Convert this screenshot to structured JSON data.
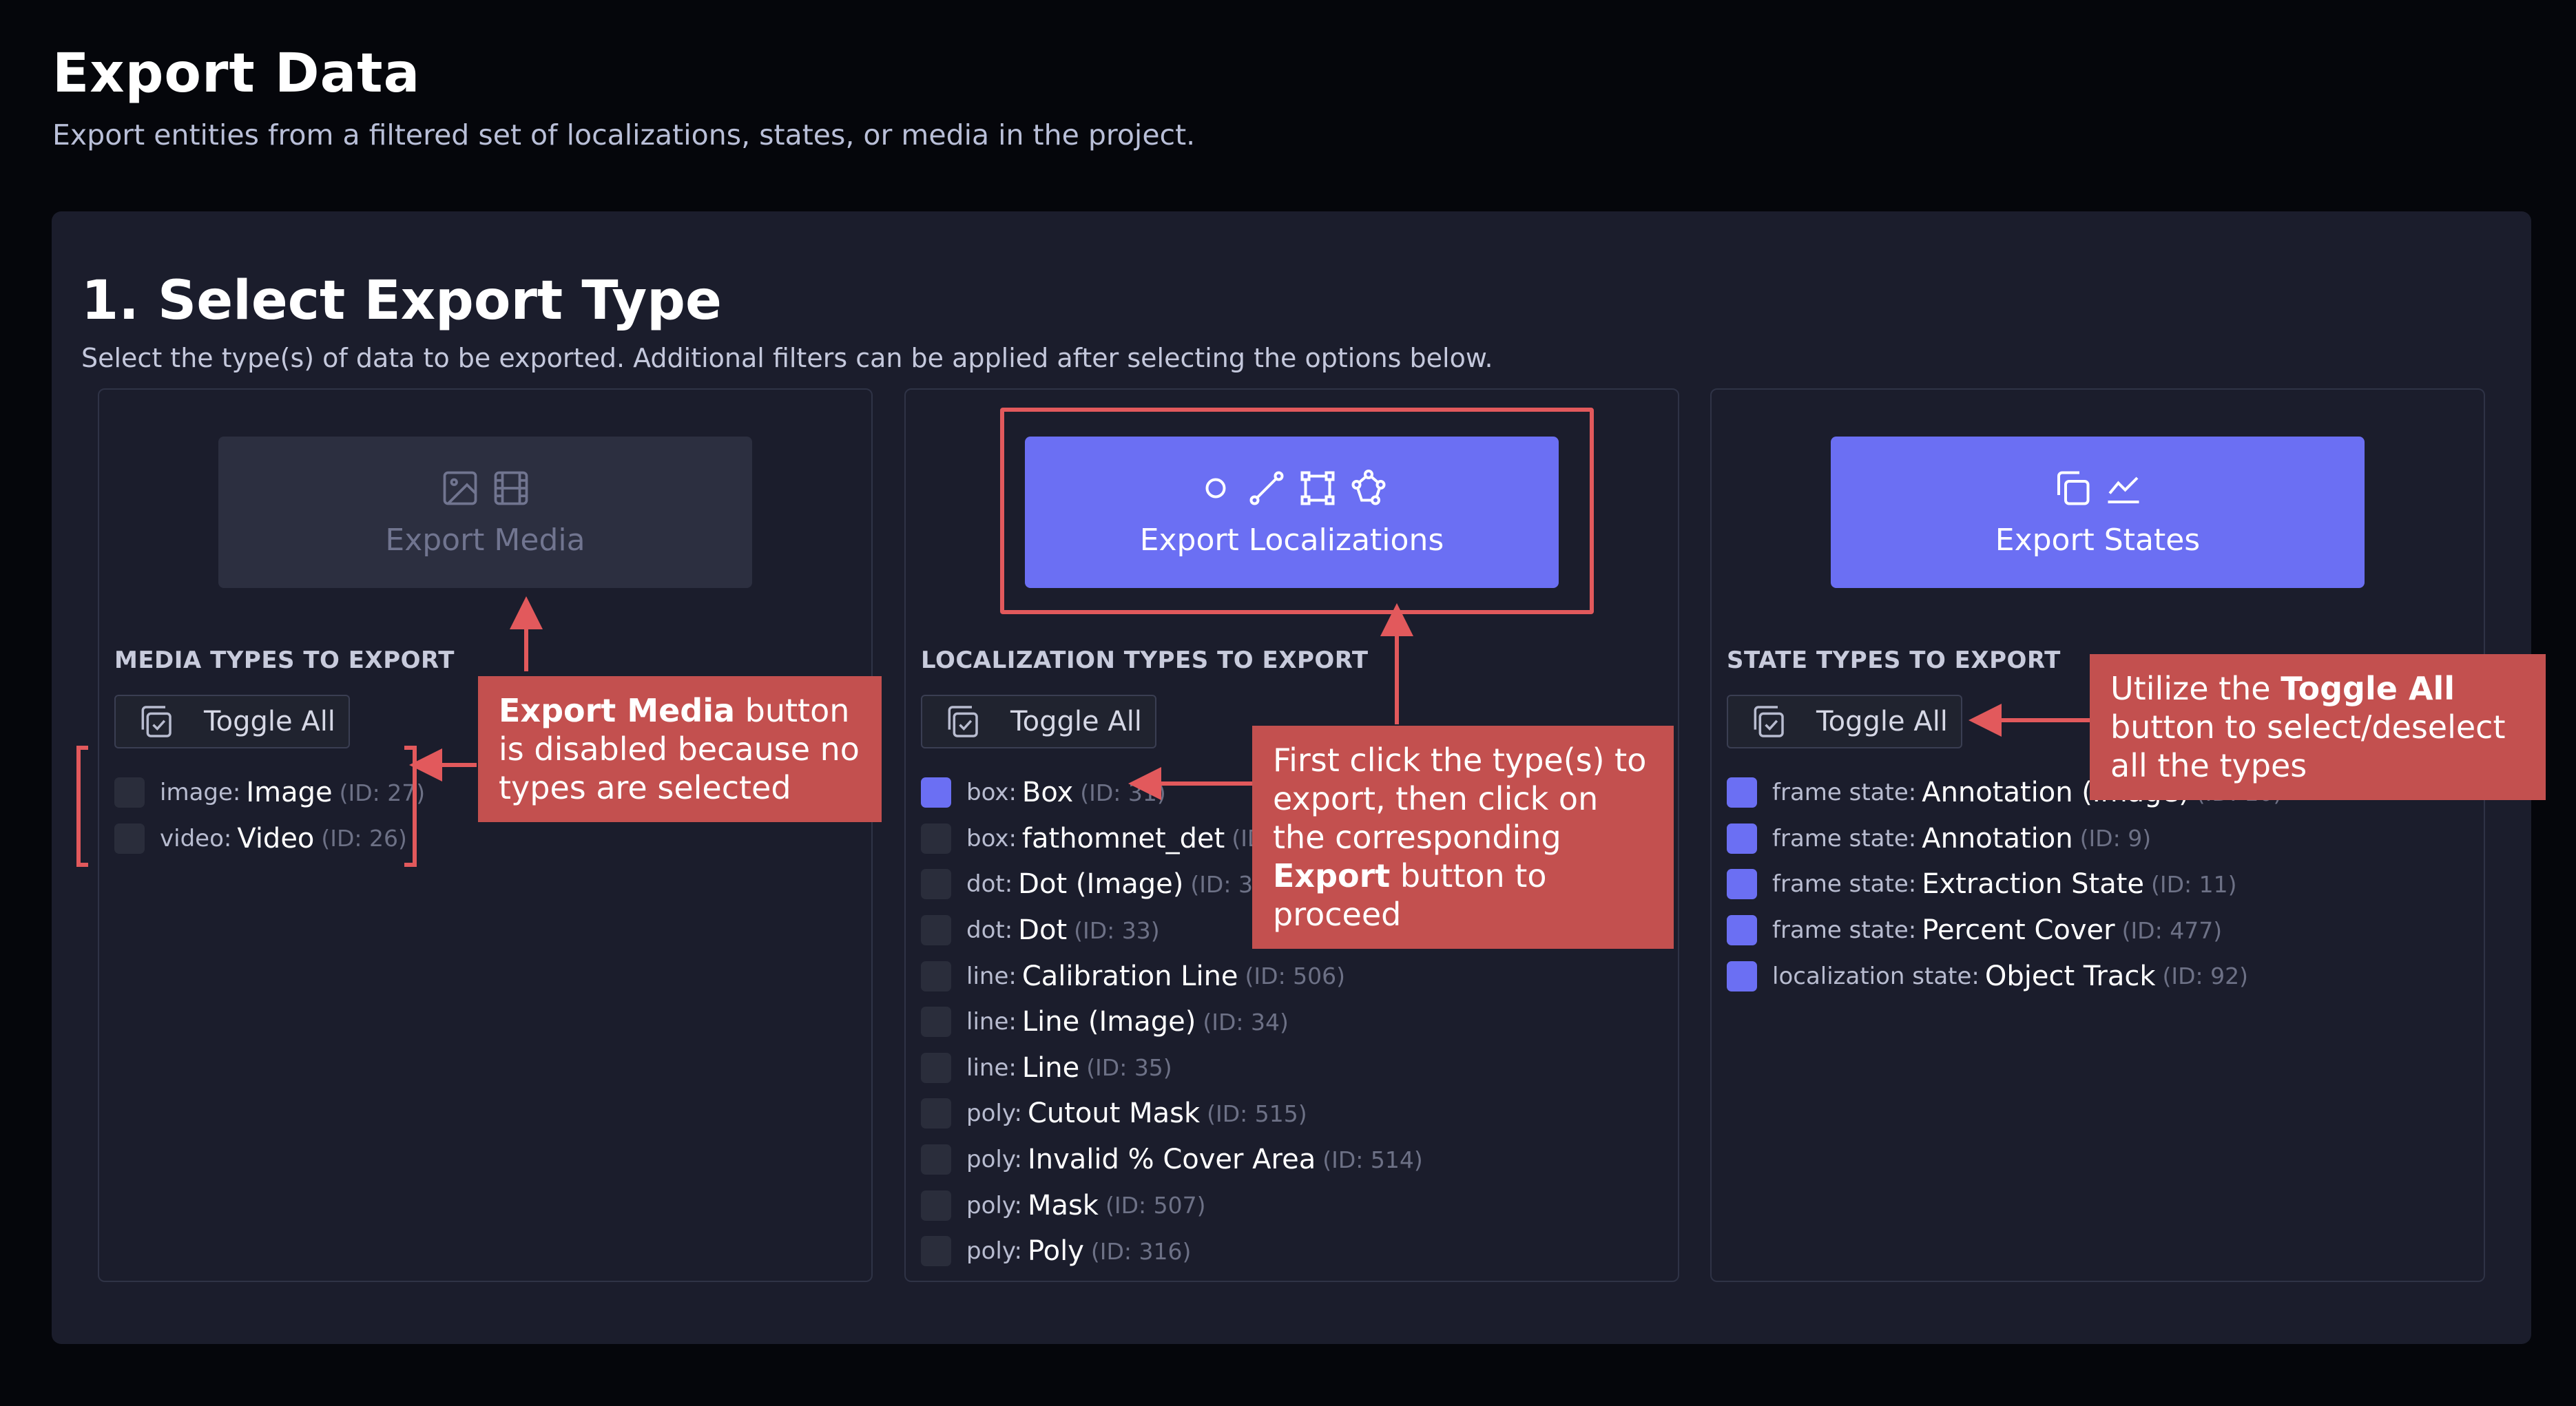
{
  "page": {
    "title": "Export Data",
    "subtitle": "Export entities from a filtered set of localizations, states, or media in the project."
  },
  "section": {
    "title": "1. Select Export Type",
    "subtitle": "Select the type(s) of data to be exported. Additional filters can be applied after selecting the options below."
  },
  "media": {
    "button_label": "Export Media",
    "button_icons": [
      "image-icon",
      "film-icon"
    ],
    "heading": "MEDIA TYPES TO EXPORT",
    "toggle_label": "Toggle All",
    "items": [
      {
        "prefix": "image:",
        "name": "Image",
        "id": "(ID: 27)",
        "checked": false
      },
      {
        "prefix": "video:",
        "name": "Video",
        "id": "(ID: 26)",
        "checked": false
      }
    ]
  },
  "localizations": {
    "button_label": "Export Localizations",
    "button_icons": [
      "dot-icon",
      "line-icon",
      "box-icon",
      "poly-icon"
    ],
    "heading": "LOCALIZATION TYPES TO EXPORT",
    "toggle_label": "Toggle All",
    "items": [
      {
        "prefix": "box:",
        "name": "Box",
        "id": "(ID: 31)",
        "checked": true
      },
      {
        "prefix": "box:",
        "name": "fathomnet_det",
        "id": "(ID: 5",
        "checked": false
      },
      {
        "prefix": "dot:",
        "name": "Dot (Image)",
        "id": "(ID: 32)",
        "checked": false
      },
      {
        "prefix": "dot:",
        "name": "Dot",
        "id": "(ID: 33)",
        "checked": false
      },
      {
        "prefix": "line:",
        "name": "Calibration Line",
        "id": "(ID: 506)",
        "checked": false
      },
      {
        "prefix": "line:",
        "name": "Line (Image)",
        "id": "(ID: 34)",
        "checked": false
      },
      {
        "prefix": "line:",
        "name": "Line",
        "id": "(ID: 35)",
        "checked": false
      },
      {
        "prefix": "poly:",
        "name": "Cutout Mask",
        "id": "(ID: 515)",
        "checked": false
      },
      {
        "prefix": "poly:",
        "name": "Invalid % Cover Area",
        "id": "(ID: 514)",
        "checked": false
      },
      {
        "prefix": "poly:",
        "name": "Mask",
        "id": "(ID: 507)",
        "checked": false
      },
      {
        "prefix": "poly:",
        "name": "Poly",
        "id": "(ID: 316)",
        "checked": false
      }
    ]
  },
  "states": {
    "button_label": "Export States",
    "button_icons": [
      "copy-icon",
      "chart-line-icon"
    ],
    "heading": "STATE TYPES TO EXPORT",
    "toggle_label": "Toggle All",
    "items": [
      {
        "prefix": "frame state:",
        "name": "Annotation (Image)",
        "id": "(ID: 10)",
        "checked": true
      },
      {
        "prefix": "frame state:",
        "name": "Annotation",
        "id": "(ID: 9)",
        "checked": true
      },
      {
        "prefix": "frame state:",
        "name": "Extraction State",
        "id": "(ID: 11)",
        "checked": true
      },
      {
        "prefix": "frame state:",
        "name": "Percent Cover",
        "id": "(ID: 477)",
        "checked": true
      },
      {
        "prefix": "localization state:",
        "name": "Object Track",
        "id": "(ID: 92)",
        "checked": true
      }
    ]
  },
  "annotations": {
    "media_note": {
      "bold": "Export Media",
      "text": " button is disabled because no types are selected"
    },
    "loc_note": {
      "text1": "First click the type(s) to export, then click on the corresponding ",
      "bold": "Export",
      "text2": " button to proceed"
    },
    "toggle_note": {
      "text1": "Utilize the ",
      "bold": "Toggle All",
      "text2": " button to select/deselect all the types"
    },
    "accent_color": "#e2595c",
    "callout_color": "#c3504f"
  }
}
